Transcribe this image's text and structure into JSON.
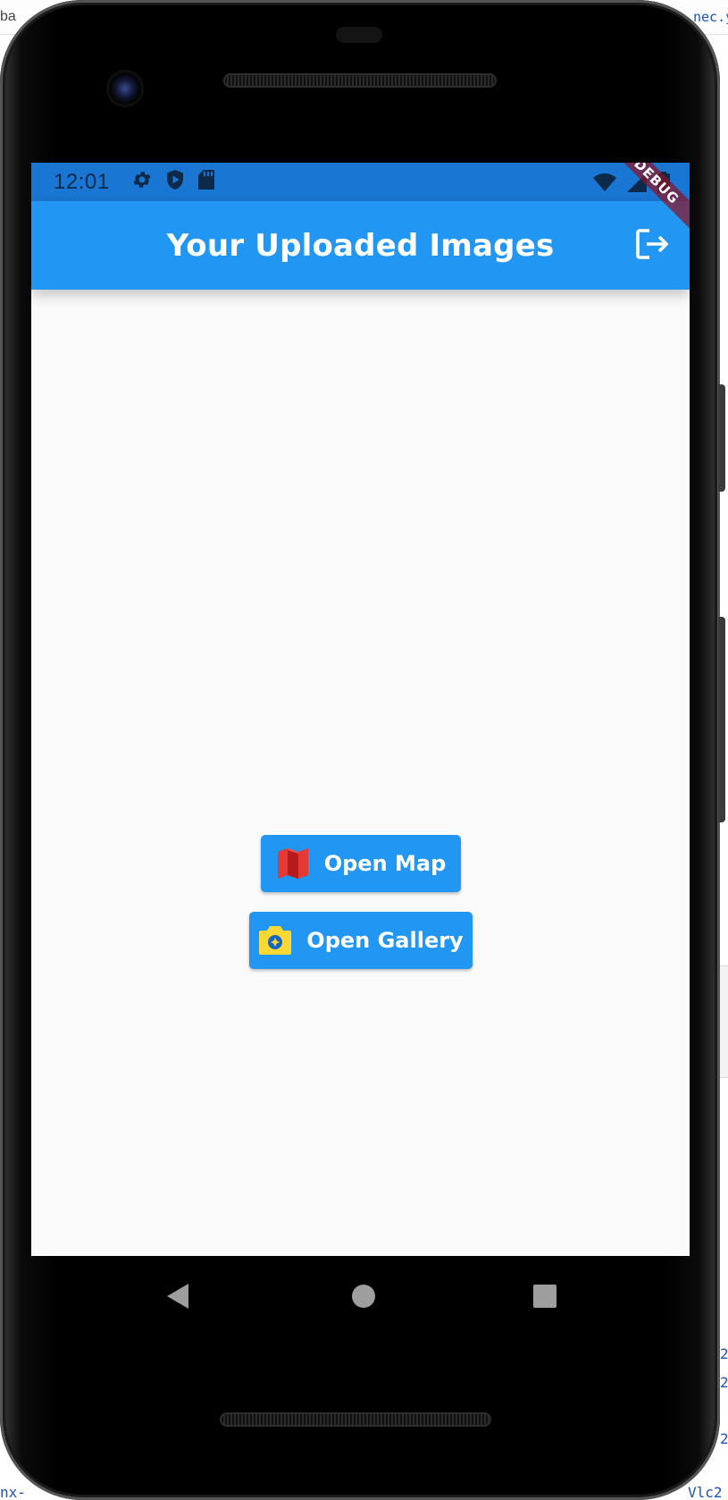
{
  "background": {
    "top_left_fragment": "ba",
    "top_right_fragment": "nec.y",
    "right_fragments": [
      "2",
      "2",
      "2"
    ],
    "bottom_left_fragment": "nx-",
    "bottom_right_fragment": "Vlc2"
  },
  "status_bar": {
    "time": "12:01",
    "left_icons": [
      "settings-icon",
      "play-protect-icon",
      "sd-card-icon"
    ],
    "right_icons": [
      "wifi-icon",
      "signal-icon",
      "battery-icon"
    ]
  },
  "app_bar": {
    "title": "Your Uploaded Images",
    "action_icon": "logout-icon"
  },
  "debug_banner": "DEBUG",
  "buttons": {
    "map": {
      "label": "Open Map",
      "icon": "map-icon"
    },
    "gallery": {
      "label": "Open Gallery",
      "icon": "camera-icon"
    }
  },
  "navigation": {
    "back": "back-icon",
    "home": "home-icon",
    "recents": "recents-icon"
  },
  "colors": {
    "app_bar": "#2196f3",
    "status_bar": "#1976d2",
    "background": "#fafafa",
    "button": "#2196f3",
    "map_icon": "#e53935",
    "camera_icon": "#fdd835"
  }
}
